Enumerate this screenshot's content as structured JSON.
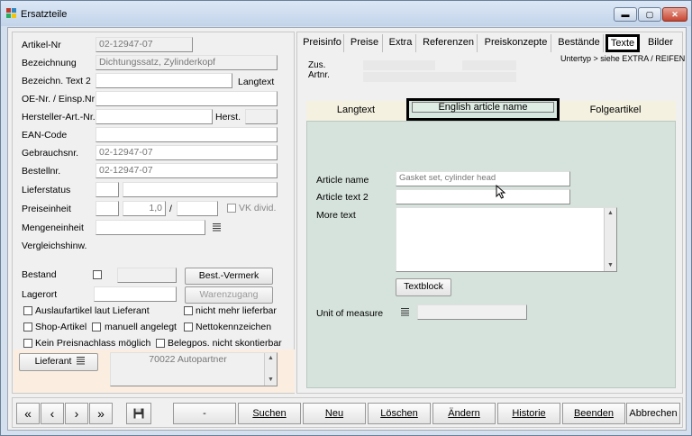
{
  "window": {
    "title": "Ersatzteile",
    "controls": {
      "minimize": "▬",
      "maximize": "▢",
      "close": "✕"
    }
  },
  "left": {
    "artikel_nr": {
      "label": "Artikel-Nr",
      "value": "02-12947-07"
    },
    "bezeichnung": {
      "label": "Bezeichnung",
      "value": "Dichtungssatz, Zylinderkopf"
    },
    "bezeichn_text2": {
      "label": "Bezeichn. Text 2",
      "value": "",
      "suffix": "Langtext"
    },
    "oe_nr": {
      "label": "OE-Nr. / Einsp.Nr",
      "value": ""
    },
    "hersteller_art_nr": {
      "label": "Hersteller-Art.-Nr.",
      "value": "",
      "suffix": "Herst."
    },
    "ean_code": {
      "label": "EAN-Code",
      "value": ""
    },
    "gebrauchsnr": {
      "label": "Gebrauchsnr.",
      "value": "02-12947-07"
    },
    "bestellnr": {
      "label": "Bestellnr.",
      "value": "02-12947-07"
    },
    "lieferstatus": {
      "label": "Lieferstatus"
    },
    "preiseinheit": {
      "label": "Preiseinheit",
      "value": "1,0",
      "sep": "/",
      "vk_divid": "VK divid."
    },
    "mengeneinheit": {
      "label": "Mengeneinheit"
    },
    "vergleichshinw": {
      "label": "Vergleichshinw."
    },
    "bestand": {
      "label": "Bestand"
    },
    "best_vermerk": "Best.-Vermerk",
    "lagerort": {
      "label": "Lagerort"
    },
    "warenzugang": "Warenzugang",
    "checkboxes": {
      "auslaufartikel": "Auslaufartikel laut Lieferant",
      "nicht_mehr_lieferbar": "nicht mehr lieferbar",
      "shop_artikel": "Shop-Artikel",
      "manuell_angelegt": "manuell angelegt",
      "nettokennzeichen": "Nettokennzeichen",
      "kein_preisnachlass": "Kein Preisnachlass möglich",
      "belegpos": "Belegpos. nicht skontierbar"
    },
    "lieferant_button": "Lieferant",
    "lieferant_value": "70022 Autopartner"
  },
  "right": {
    "tabs": [
      "Preisinfo",
      "Preise",
      "Extra",
      "Referenzen",
      "Preiskonzepte",
      "Bestände",
      "Texte",
      "Bilder"
    ],
    "active_tab": "Texte",
    "untertyp": "Untertyp > siehe EXTRA / REIFEN",
    "zus_label": "Zus.",
    "artnr_label": "Artnr.",
    "inner_tabs": [
      "Langtext",
      "English article name",
      "Folgeartikel"
    ],
    "active_inner_tab": "English article name",
    "article_name": {
      "label": "Article name",
      "value": "Gasket set, cylinder head"
    },
    "article_text2": {
      "label": "Article text 2",
      "value": ""
    },
    "more_text": {
      "label": "More text",
      "value": ""
    },
    "textblock_button": "Textblock",
    "unit_of_measure": {
      "label": "Unit of measure",
      "value": ""
    }
  },
  "toolbar": {
    "first": "«",
    "prev": "‹",
    "next": "›",
    "last": "»",
    "save_icon": "floppy-icon",
    "dash": "-",
    "suchen": "Suchen",
    "neu": "Neu",
    "loeschen": "Löschen",
    "aendern": "Ändern",
    "historie": "Historie",
    "beenden": "Beenden",
    "abbrechen": "Abbrechen"
  }
}
